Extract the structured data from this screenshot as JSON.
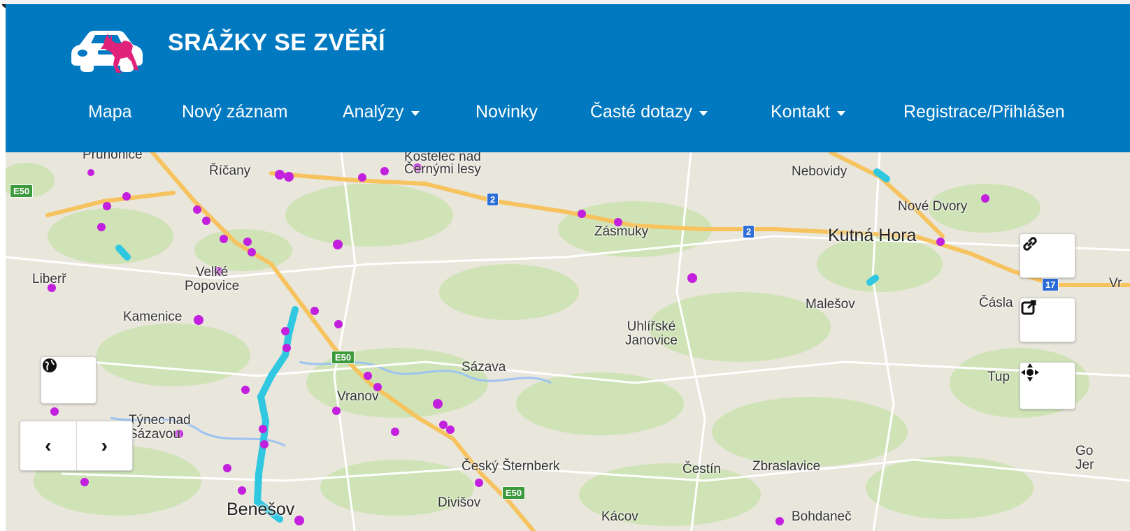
{
  "brand": {
    "title": "SRÁŽKY SE ZVĚŘÍ",
    "logo": "car-with-deer-logo"
  },
  "nav": [
    {
      "label": "Mapa",
      "dropdown": false
    },
    {
      "label": "Nový záznam",
      "dropdown": false
    },
    {
      "label": "Analýzy",
      "dropdown": true
    },
    {
      "label": "Novinky",
      "dropdown": false
    },
    {
      "label": "Časté dotazy",
      "dropdown": true
    },
    {
      "label": "Kontakt",
      "dropdown": true
    },
    {
      "label": "Registrace/Přihlášen",
      "dropdown": false
    }
  ],
  "map": {
    "places": [
      "Průhonice",
      "Říčany",
      "Kostelec nad\nČernými lesy",
      "Nebovidy",
      "Nové Dvory",
      "Zásmuky",
      "Kutná Hora",
      "Liberř",
      "Velké\nPopovice",
      "Malešov",
      "Čásla",
      "Kamenice",
      "Uhlířské\nJanovice",
      "Sázava",
      "Tup",
      "Vranov",
      "Týnec nad\nSázavou",
      "Český Šternberk",
      "Čestín",
      "Zbraslavice",
      "Go\nJer",
      "Divišov",
      "Benešov",
      "Kácov",
      "Bohdaneč",
      "Vr"
    ],
    "shields": [
      {
        "text": "E50",
        "color": "green"
      },
      {
        "text": "2",
        "color": "blue"
      },
      {
        "text": "2",
        "color": "blue"
      },
      {
        "text": "17",
        "color": "blue"
      },
      {
        "text": "E50",
        "color": "green"
      },
      {
        "text": "E50",
        "color": "green"
      }
    ],
    "colors": {
      "header": "#0079c1",
      "incident_points": "#c21fde",
      "incident_segments": "#2fc8e0",
      "highway": "#f6c35e"
    }
  },
  "controls": {
    "right": [
      "link-icon",
      "share-icon",
      "locate-icon"
    ],
    "left": [
      "globe-icon",
      "chevron-left-icon",
      "chevron-right-icon"
    ]
  }
}
